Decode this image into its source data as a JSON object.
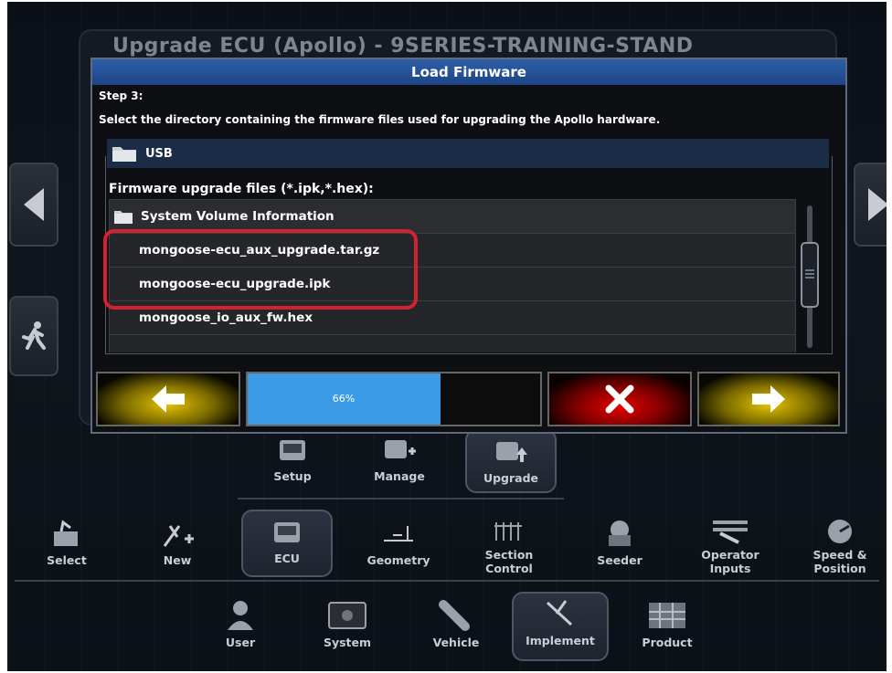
{
  "background": {
    "title": "Upgrade ECU (Apollo) - 9SERIES-TRAINING-STAND"
  },
  "side_buttons": {
    "left_icon": "chevron-left-icon",
    "right_icon": "chevron-right-icon",
    "run_icon": "running-man-icon"
  },
  "dialog": {
    "title": "Load Firmware",
    "step": "Step 3:",
    "instruction": "Select the directory containing the firmware files used for upgrading the Apollo hardware.",
    "directory": "USB",
    "files_label": "Firmware upgrade files (*.ipk,*.hex):",
    "files": [
      {
        "name": "System Volume Information",
        "type": "folder"
      },
      {
        "name": "mongoose-ecu_aux_upgrade.tar.gz",
        "type": "file"
      },
      {
        "name": "mongoose-ecu_upgrade.ipk",
        "type": "file"
      },
      {
        "name": "mongoose_io_aux_fw.hex",
        "type": "file"
      },
      {
        "name": "",
        "type": "file"
      }
    ],
    "progress": 0.66,
    "progress_label": "66%"
  },
  "nav_top": [
    {
      "label": "Setup",
      "icon": "ecu-setup-icon"
    },
    {
      "label": "Manage",
      "icon": "ecu-manage-icon"
    },
    {
      "label": "Upgrade",
      "icon": "ecu-upgrade-icon"
    }
  ],
  "nav_mid": [
    {
      "label": "Select",
      "icon": "select-implement-icon"
    },
    {
      "label": "New",
      "icon": "new-implement-icon"
    },
    {
      "label": "ECU",
      "icon": "ecu-icon"
    },
    {
      "label": "Geometry",
      "icon": "geometry-icon"
    },
    {
      "label": "Section Control",
      "icon": "section-control-icon"
    },
    {
      "label": "Seeder",
      "icon": "seeder-icon"
    },
    {
      "label": "Operator Inputs",
      "icon": "operator-inputs-icon"
    },
    {
      "label": "Speed & Position",
      "icon": "speed-position-icon"
    }
  ],
  "nav_bottom": [
    {
      "label": "User",
      "icon": "user-icon"
    },
    {
      "label": "System",
      "icon": "system-icon"
    },
    {
      "label": "Vehicle",
      "icon": "vehicle-icon"
    },
    {
      "label": "Implement",
      "icon": "implement-icon"
    },
    {
      "label": "Product",
      "icon": "product-icon"
    }
  ]
}
